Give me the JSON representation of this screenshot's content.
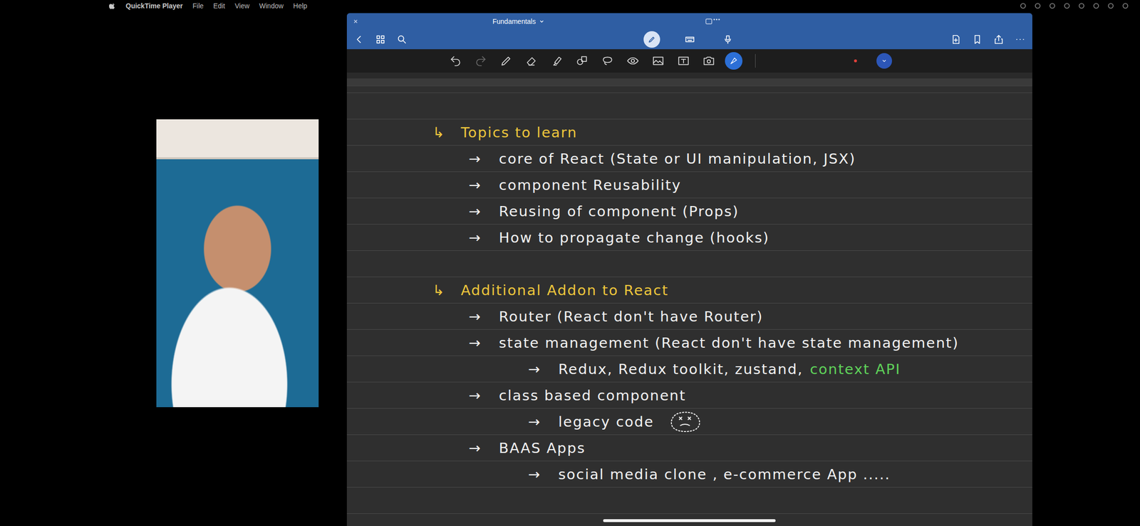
{
  "menubar": {
    "app": "QuickTime Player",
    "menus": [
      "File",
      "Edit",
      "View",
      "Window",
      "Help"
    ]
  },
  "window": {
    "title": "Fundamentals"
  },
  "notes": [
    {
      "heading": "Topics to learn",
      "marker": "↳",
      "items": [
        {
          "kind": "item",
          "marker": "→",
          "text": "core of React (State or UI manipulation, JSX)"
        },
        {
          "kind": "item",
          "marker": "→",
          "text": "component Reusability"
        },
        {
          "kind": "item",
          "marker": "→",
          "text": "Reusing of component (Props)"
        },
        {
          "kind": "item",
          "marker": "→",
          "text": "How to propagate change (hooks)"
        }
      ]
    },
    {
      "heading": "Additional Addon to React",
      "marker": "↳",
      "items": [
        {
          "kind": "item",
          "marker": "→",
          "text": "Router (React don't have Router)"
        },
        {
          "kind": "item",
          "marker": "→",
          "text": "state management (React don't have state management)"
        },
        {
          "kind": "subitem",
          "marker": "→",
          "parts": [
            {
              "text": "Redux, Redux toolkit, zustand,",
              "color": "#f2f2f2"
            },
            {
              "text": "context API",
              "color": "#5fd35a"
            }
          ]
        },
        {
          "kind": "item",
          "marker": "→",
          "text": "class based component"
        },
        {
          "kind": "subitem-face",
          "marker": "→",
          "text": "legacy code"
        },
        {
          "kind": "item",
          "marker": "→",
          "text": "BAAS Apps"
        },
        {
          "kind": "subitem",
          "marker": "→",
          "text": "social media clone , e-commerce App ....."
        }
      ]
    }
  ]
}
